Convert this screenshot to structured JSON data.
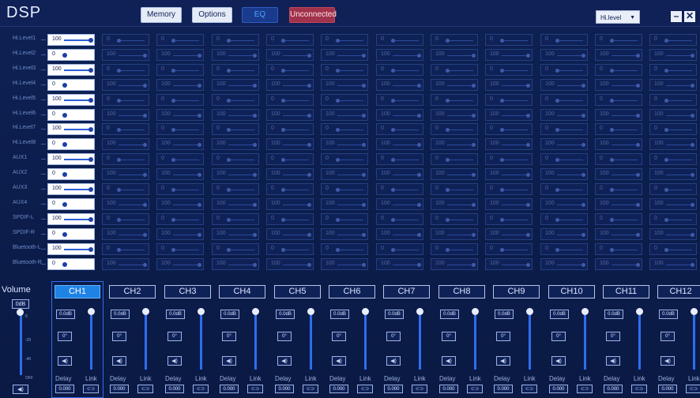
{
  "app": {
    "title": "DSP"
  },
  "toolbar": {
    "memory": "Memory",
    "options": "Options",
    "eq": "EQ",
    "status": "Unconnected"
  },
  "level_select": {
    "value": "Hi.level",
    "options": [
      "Hi.level"
    ]
  },
  "window": {
    "minimize": "–",
    "close": "✕"
  },
  "colors": {
    "background": "#0b1a45",
    "accent": "#1f83e6",
    "status": "#a0324b",
    "fader": "#2f6df0"
  },
  "matrix": {
    "inputs": [
      "Hi.Level1",
      "Hi.Level2",
      "Hi.Level3",
      "Hi.Level4",
      "Hi.Level5",
      "Hi.Level6",
      "Hi.Level7",
      "Hi.Level8",
      "AUX1",
      "AUX2",
      "AUX3",
      "AUX4",
      "SPDIF-L",
      "SPDIF-R",
      "Bluetooth-L",
      "Bluetooth-R"
    ],
    "row_values": [
      "100",
      "0",
      "100",
      "0",
      "100",
      "0",
      "100",
      "0",
      "100",
      "0",
      "100",
      "0",
      "100",
      "0",
      "100",
      "0"
    ],
    "alt_values": [
      "0",
      "100",
      "0",
      "100",
      "0",
      "100",
      "0",
      "100",
      "0",
      "100",
      "0",
      "100",
      "0",
      "100",
      "0",
      "100"
    ],
    "inactive_alt_values": [
      "0",
      "100",
      "0",
      "100",
      "0",
      "100",
      "0",
      "100",
      "0",
      "100",
      "0",
      "100",
      "0",
      "100",
      "0",
      "100"
    ]
  },
  "volume": {
    "label": "Volume",
    "db": "0dB",
    "scale": [
      "6",
      "-20",
      "-40",
      "OFF"
    ],
    "mute_icon": "speaker-icon",
    "mute": "◀)"
  },
  "channel_fields": {
    "gain": "0.0dB",
    "phase": "0°",
    "delay_label": "Delay",
    "link_label": "Link",
    "delay": "0.000",
    "link": "⊂⊃",
    "mute": "◀)"
  },
  "channels": [
    {
      "name": "CH1",
      "active": true
    },
    {
      "name": "CH2"
    },
    {
      "name": "CH3"
    },
    {
      "name": "CH4"
    },
    {
      "name": "CH5"
    },
    {
      "name": "CH6"
    },
    {
      "name": "CH7"
    },
    {
      "name": "CH8"
    },
    {
      "name": "CH9"
    },
    {
      "name": "CH10"
    },
    {
      "name": "CH11"
    },
    {
      "name": "CH12"
    }
  ]
}
